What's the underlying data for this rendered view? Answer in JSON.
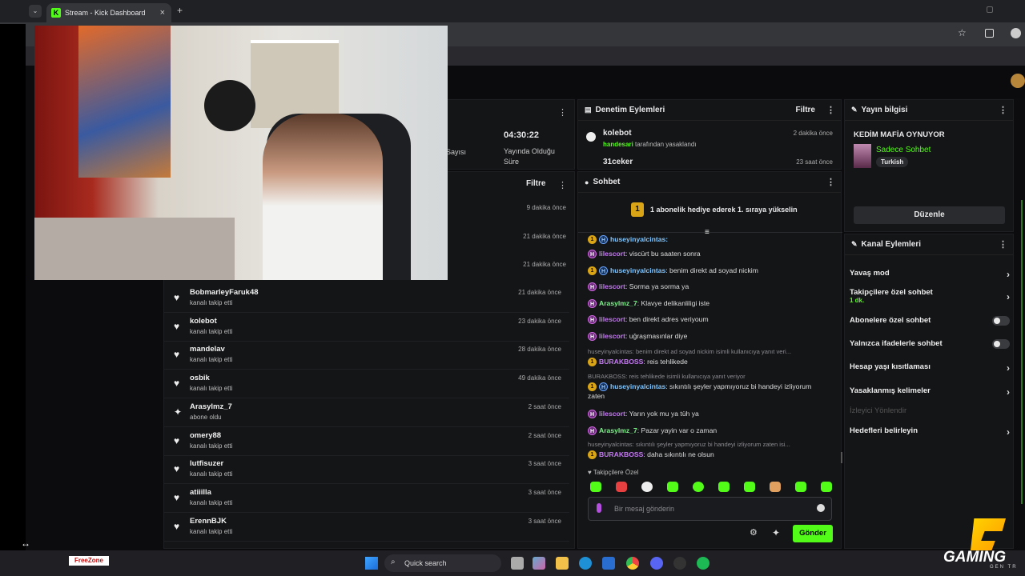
{
  "browser": {
    "tab_title": "Stream - Kick Dashboard",
    "new_tab": "+",
    "close_tab": "×"
  },
  "stream_stats": {
    "duration_value": "04:30:22",
    "duration_label": "Yayında Olduğu Süre",
    "viewers_label": "Sayısı"
  },
  "feed": {
    "filter_label": "Filtre",
    "early_times": [
      "9 dakika önce",
      "21 dakika önce",
      "21 dakika önce"
    ],
    "items": [
      {
        "name": "BobmarleyFaruk48",
        "action": "kanalı takip etti",
        "time": "21 dakika önce",
        "icon": "heart-icon"
      },
      {
        "name": "kolebot",
        "action": "kanalı takip etti",
        "time": "23 dakika önce",
        "icon": "heart-icon"
      },
      {
        "name": "mandelav",
        "action": "kanalı takip etti",
        "time": "28 dakika önce",
        "icon": "heart-icon"
      },
      {
        "name": "osbik",
        "action": "kanalı takip etti",
        "time": "49 dakika önce",
        "icon": "heart-icon"
      },
      {
        "name": "Arasylmz_7",
        "action": "abone oldu",
        "time": "2 saat önce",
        "icon": "sparkle-icon"
      },
      {
        "name": "omery88",
        "action": "kanalı takip etti",
        "time": "2 saat önce",
        "icon": "heart-icon"
      },
      {
        "name": "lutfisuzer",
        "action": "kanalı takip etti",
        "time": "3 saat önce",
        "icon": "heart-icon"
      },
      {
        "name": "atiiilla",
        "action": "kanalı takip etti",
        "time": "3 saat önce",
        "icon": "heart-icon"
      },
      {
        "name": "ErennBJK",
        "action": "kanalı takip etti",
        "time": "3 saat önce",
        "icon": "heart-icon"
      }
    ]
  },
  "moderation": {
    "title": "Denetim Eylemleri",
    "filter_label": "Filtre",
    "items": [
      {
        "user": "kolebot",
        "by": "handesari",
        "detail": "tarafından yasaklandı",
        "time": "2 dakika önce"
      },
      {
        "user": "31ceker",
        "time": "23 saat önce"
      }
    ]
  },
  "chat": {
    "title": "Sohbet",
    "banner_rank": "1",
    "banner_text": "1 abonelik hediye ederek 1. sıraya yükselin",
    "partial_user": "huseyinyalcintas:",
    "messages": [
      {
        "user": "lilescort",
        "text": ": viscürt bu saaten sonra",
        "color": "u-purple",
        "badges": [
          "b-purple"
        ]
      },
      {
        "user": "huseyinyalcintas",
        "text": ": benim direkt ad soyad nickim",
        "color": "u-blue",
        "badges": [
          "b-gold",
          "b-blue"
        ]
      },
      {
        "user": "lilescort",
        "text": ": Sorma ya sorma ya",
        "color": "u-purple",
        "badges": [
          "b-purple"
        ]
      },
      {
        "user": "Arasylmz_7",
        "text": ": Klavye delikanliligi iste",
        "color": "u-green",
        "badges": [
          "b-purple"
        ]
      },
      {
        "user": "lilescort",
        "text": ": ben direkt adres veriyoum",
        "color": "u-purple",
        "badges": [
          "b-purple"
        ]
      },
      {
        "user": "lilescort",
        "text": ": uğraşmasınlar diye",
        "color": "u-purple",
        "badges": [
          "b-purple"
        ]
      }
    ],
    "reply1": "huseyinyalcintas: benim direkt ad soyad nickim isimli kullanıcıya yanıt veri...",
    "msg_burak1_user": "BURAKBOSS",
    "msg_burak1_text": ": reis tehlikede",
    "reply2": "BURAKBOSS: reis tehlikede isimli kullanıcıya yanıt veriyor",
    "msg_hus_user": "huseyinyalcintas",
    "msg_hus_text": ": sıkıntılı şeyler yapmıyoruz bi handeyi izliyorum zaten",
    "msg_lil_user": "lilescort",
    "msg_lil_text": ": Yarın yok mu ya tüh ya",
    "msg_ara_user": "Arasylmz_7",
    "msg_ara_text": ": Pazar yayin var o zaman",
    "reply3": "huseyinyalcintas: sıkıntılı şeyler yapmıyoruz bi handeyi izliyorum zaten isi...",
    "msg_burak2_user": "BURAKBOSS",
    "msg_burak2_text": ": daha sıkıntılı ne olsun",
    "followers_only": "Takipçilere Özel",
    "input_placeholder": "Bir mesaj gönderin",
    "send_label": "Gönder"
  },
  "stream_info": {
    "title": "Yayın bilgisi",
    "stream_title": "KEDİM MAFİA OYNUYOR",
    "category": "Sadece Sohbet",
    "language": "Turkish",
    "edit_label": "Düzenle"
  },
  "channel_actions": {
    "title": "Kanal Eylemleri",
    "slow_mode": "Yavaş mod",
    "followers_chat": "Takipçilere özel sohbet",
    "followers_chat_duration": "1 dk.",
    "subs_chat": "Abonelere özel sohbet",
    "emotes_chat": "Yalnızca ifadelerle sohbet",
    "age_restriction": "Hesap yaşı kısıtlaması",
    "banned_words": "Yasaklanmış kelimeler",
    "viewer_redirect": "İzleyici Yönlendir",
    "set_goals": "Hedefleri belirleyin"
  },
  "taskbar": {
    "search": "Quick search",
    "freezone": "FreeZone"
  },
  "watermark": {
    "text": "GAMING",
    "subtext": "GEN TR"
  },
  "colors": {
    "accent": "#53fc18",
    "panel": "#141517",
    "bg": "#0c0c0f"
  }
}
